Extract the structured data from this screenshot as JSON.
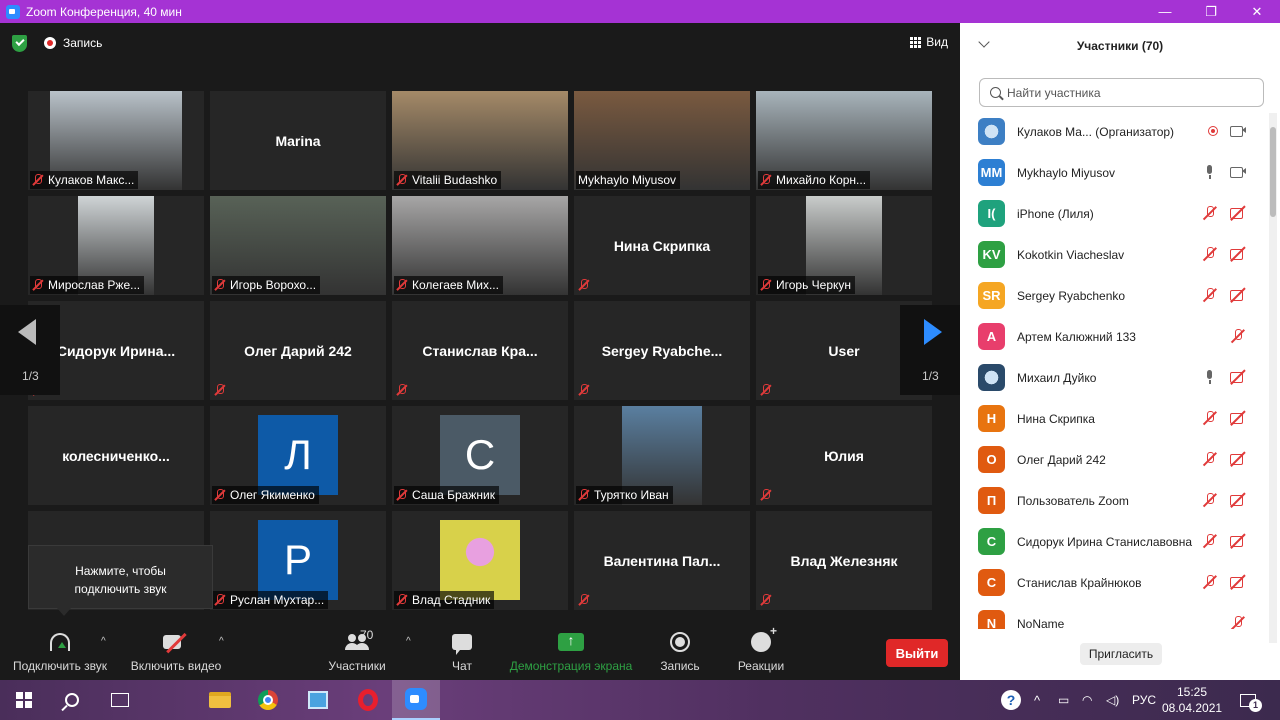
{
  "window": {
    "title": "Zoom Конференция, 40 мин",
    "min": "—",
    "restore": "❐",
    "close": "✕"
  },
  "topbar": {
    "recording_label": "Запись",
    "view_label": "Вид"
  },
  "pager": {
    "left": "1/3",
    "right": "1/3"
  },
  "tiles": [
    {
      "name": "Кулаков Макс...",
      "video": true,
      "bg": "#b9c2c9",
      "vx": 22,
      "vw": 132,
      "muted": true
    },
    {
      "name": "Marina",
      "center": true,
      "muted": false
    },
    {
      "name": "Vitalii Budashko",
      "video": true,
      "bg": "#a58a68",
      "vx": 0,
      "vw": 176,
      "muted": true
    },
    {
      "name": "Mykhaylo Miyusov",
      "video": true,
      "bg": "#7a5a40",
      "vx": 0,
      "vw": 176,
      "muted": false,
      "active": true
    },
    {
      "name": "Михайло Корн...",
      "video": true,
      "bg": "#a8b4bb",
      "vx": 0,
      "vw": 176,
      "muted": true
    },
    {
      "name": "Мирослав Рже...",
      "video": true,
      "bg": "#cfd4d6",
      "vx": 50,
      "vw": 76,
      "muted": true
    },
    {
      "name": "Игорь Ворохо...",
      "video": true,
      "bg": "#586257",
      "vx": 0,
      "vw": 176,
      "muted": true
    },
    {
      "name": "Колегаев Мих...",
      "video": true,
      "bg": "#a7a6a6",
      "vx": 0,
      "vw": 176,
      "muted": true
    },
    {
      "name": "",
      "center_text": "Нина Скрипка",
      "muted": true
    },
    {
      "name": "Игорь Черкун",
      "video": true,
      "bg": "#c9cccb",
      "vx": 50,
      "vw": 76,
      "muted": true
    },
    {
      "name": "",
      "center_text": "Сидорук  Ирина...",
      "muted": true
    },
    {
      "name": "",
      "center_text": "Олег Дарий 242",
      "muted": true
    },
    {
      "name": "",
      "center_text": "Станислав  Кра...",
      "muted": true
    },
    {
      "name": "",
      "center_text": "Sergey  Ryabche...",
      "muted": true
    },
    {
      "name": "",
      "center_text": "User",
      "muted": true
    },
    {
      "name": "",
      "center_text": "колесниченко...",
      "muted": false
    },
    {
      "name": "Олег Якименко",
      "avatar": "Л",
      "avatar_bg": "#0e5aa7",
      "muted": true
    },
    {
      "name": "Саша Бражник",
      "avatar": "С",
      "avatar_bg": "#4b5a66",
      "muted": true
    },
    {
      "name": "Турятко Иван",
      "video": true,
      "bg": "#5a7fa0",
      "vx": 48,
      "vw": 80,
      "muted": true
    },
    {
      "name": "",
      "center_text": "Юлия",
      "muted": true
    },
    {
      "name": "",
      "center_text": "",
      "muted": false
    },
    {
      "name": "Руслан Мухтар...",
      "avatar": "Р",
      "avatar_bg": "#0e5aa7",
      "muted": true
    },
    {
      "name": "Влад Стадник",
      "avatar": "",
      "avatar_bg": "#d8d14a",
      "avatar_img": true,
      "muted": true
    },
    {
      "name": "",
      "center_text": "Валентина  Пал...",
      "muted": true
    },
    {
      "name": "",
      "center_text": "Влад Железняк",
      "muted": true
    }
  ],
  "tooltip": {
    "line1": "Нажмите, чтобы",
    "line2": "подключить звук"
  },
  "toolbar": {
    "audio": "Подключить звук",
    "video": "Включить видео",
    "participants": "Участники",
    "participants_count": "70",
    "chat": "Чат",
    "share": "Демонстрация экрана",
    "record": "Запись",
    "reactions": "Реакции",
    "leave": "Выйти",
    "caret": "^",
    "share_color": "#2ea043"
  },
  "panel": {
    "title": "Участники (70)",
    "search_placeholder": "Найти участника",
    "invite": "Пригласить",
    "participants": [
      {
        "initials": "",
        "name": "Кулаков Ма... (Организатор)",
        "color": "#3d7fc4",
        "image": true,
        "icons": [
          "rec-on",
          "cam-on"
        ]
      },
      {
        "initials": "MM",
        "name": "Mykhaylo Miyusov",
        "color": "#2d7fd3",
        "icons": [
          "mic-on",
          "cam-on"
        ]
      },
      {
        "initials": "I(",
        "name": "iPhone (Лиля)",
        "color": "#1fa27d",
        "icons": [
          "mic-muted",
          "cam-muted"
        ]
      },
      {
        "initials": "KV",
        "name": "Kokotkin Viacheslav",
        "color": "#2ea043",
        "icons": [
          "mic-muted",
          "cam-muted"
        ]
      },
      {
        "initials": "SR",
        "name": "Sergey Ryabchenko",
        "color": "#f5a623",
        "icons": [
          "mic-muted",
          "cam-muted"
        ]
      },
      {
        "initials": "A",
        "name": "Артем Калюжний 133",
        "color": "#e83e6c",
        "icons": [
          "blank",
          "mic-muted"
        ]
      },
      {
        "initials": "",
        "name": "Михаил Дуйко",
        "color": "#2a4a6a",
        "image": true,
        "icons": [
          "mic-on",
          "cam-muted"
        ]
      },
      {
        "initials": "Н",
        "name": "Нина Скрипка",
        "color": "#e8740f",
        "icons": [
          "mic-muted",
          "cam-muted"
        ]
      },
      {
        "initials": "О",
        "name": "Олег Дарий 242",
        "color": "#e05a10",
        "icons": [
          "mic-muted",
          "cam-muted"
        ]
      },
      {
        "initials": "П",
        "name": "Пользователь Zoom",
        "color": "#e05a10",
        "icons": [
          "mic-muted",
          "cam-muted"
        ]
      },
      {
        "initials": "С",
        "name": "Сидорук Ирина Станиславовна",
        "color": "#2ea043",
        "icons": [
          "mic-muted",
          "cam-muted"
        ]
      },
      {
        "initials": "С",
        "name": "Станислав Крайнюков",
        "color": "#e05a10",
        "icons": [
          "mic-muted",
          "cam-muted"
        ]
      },
      {
        "initials": "N",
        "name": "NoName",
        "color": "#e05a10",
        "icons": [
          "blank",
          "mic-muted"
        ]
      }
    ]
  },
  "taskbar": {
    "lang": "РУС",
    "time": "15:25",
    "date": "08.04.2021",
    "help": "?",
    "notif_count": "1",
    "tray_up": "^"
  }
}
